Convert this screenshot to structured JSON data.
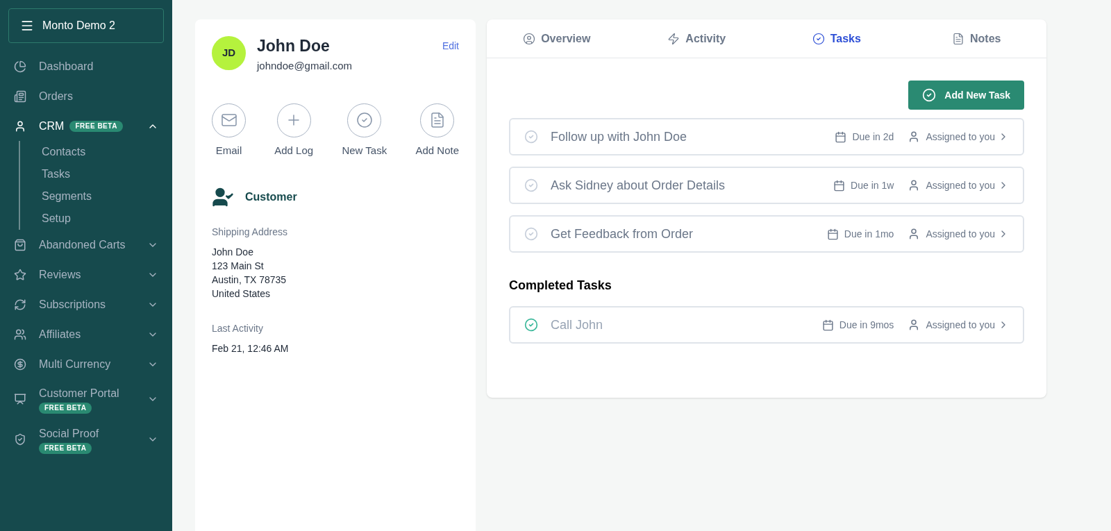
{
  "sidebar": {
    "workspace": "Monto Demo 2",
    "items": [
      {
        "label": "Dashboard"
      },
      {
        "label": "Orders"
      },
      {
        "label": "CRM",
        "badge": "FREE BETA",
        "expanded": true,
        "children": [
          {
            "label": "Contacts"
          },
          {
            "label": "Tasks"
          },
          {
            "label": "Segments"
          },
          {
            "label": "Setup"
          }
        ]
      },
      {
        "label": "Abandoned Carts",
        "expanded": false
      },
      {
        "label": "Reviews",
        "expanded": false
      },
      {
        "label": "Subscriptions",
        "expanded": false
      },
      {
        "label": "Affiliates",
        "expanded": false
      },
      {
        "label": "Multi Currency",
        "expanded": false
      },
      {
        "label": "Customer Portal",
        "badge": "FREE BETA",
        "expanded": false
      },
      {
        "label": "Social Proof",
        "badge": "FREE BETA",
        "expanded": false
      }
    ]
  },
  "contact": {
    "initials": "JD",
    "name": "John Doe",
    "email": "johndoe@gmail.com",
    "edit": "Edit",
    "actions": [
      {
        "label": "Email"
      },
      {
        "label": "Add Log"
      },
      {
        "label": "New Task"
      },
      {
        "label": "Add Note"
      }
    ],
    "type": "Customer",
    "fields": [
      {
        "label": "Shipping Address",
        "lines": [
          "John Doe",
          "123 Main St",
          "Austin, TX 78735",
          "United States"
        ]
      },
      {
        "label": "Last Activity",
        "lines": [
          "Feb 21, 12:46 AM"
        ]
      }
    ]
  },
  "tabs": [
    {
      "label": "Overview",
      "selected": false
    },
    {
      "label": "Activity",
      "selected": false
    },
    {
      "label": "Tasks",
      "selected": true
    },
    {
      "label": "Notes",
      "selected": false
    }
  ],
  "add_task": "Add New Task",
  "tasks": [
    {
      "title": "Follow up with John Doe",
      "due": "Due in 2d",
      "assignee": "Assigned to you",
      "completed": false
    },
    {
      "title": "Ask Sidney about Order Details",
      "due": "Due in 1w",
      "assignee": "Assigned to you",
      "completed": false
    },
    {
      "title": "Get Feedback from Order",
      "due": "Due in 1mo",
      "assignee": "Assigned to you",
      "completed": false
    }
  ],
  "completed_heading": "Completed Tasks",
  "completed_tasks": [
    {
      "title": "Call John",
      "due": "Due in 9mos",
      "assignee": "Assigned to you",
      "completed": true
    }
  ]
}
